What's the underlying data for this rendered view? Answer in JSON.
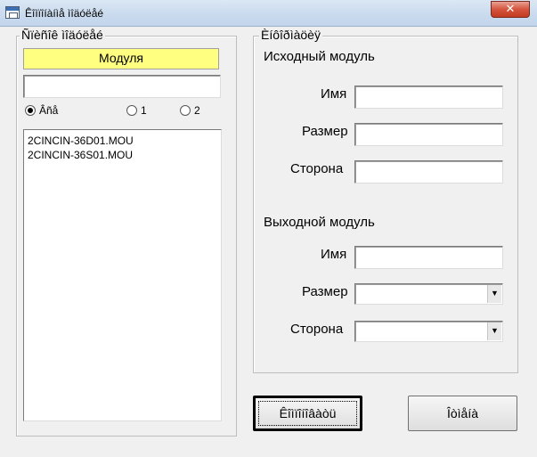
{
  "window": {
    "title": "Êîìïîíàíìå ìîäóëåé",
    "close_symbol": "✕"
  },
  "left_group": {
    "legend": "Ñïèñîê ìîäóëåé",
    "header_label": "Модуля",
    "filter_value": "",
    "radios": [
      {
        "label": "Âñå",
        "selected": true
      },
      {
        "label": "1",
        "selected": false
      },
      {
        "label": "2",
        "selected": false
      }
    ],
    "files": [
      "2CINCIN-36D01.MOU",
      "2CINCIN-36S01.MOU"
    ]
  },
  "right_group": {
    "legend": "Èíôîðìàöèÿ",
    "source": {
      "heading": "Исходный модуль",
      "name_label": "Имя",
      "name_value": "",
      "size_label": "Размер",
      "size_value": "",
      "side_label": "Сторона",
      "side_value": ""
    },
    "output": {
      "heading": "Выходной модуль",
      "name_label": "Имя",
      "name_value": "",
      "size_label": "Размер",
      "size_value": "",
      "side_label": "Сторона",
      "side_value": ""
    }
  },
  "buttons": {
    "convert_label": "Êîìïîíîâàòü",
    "cancel_label": "Îòìåíà"
  }
}
